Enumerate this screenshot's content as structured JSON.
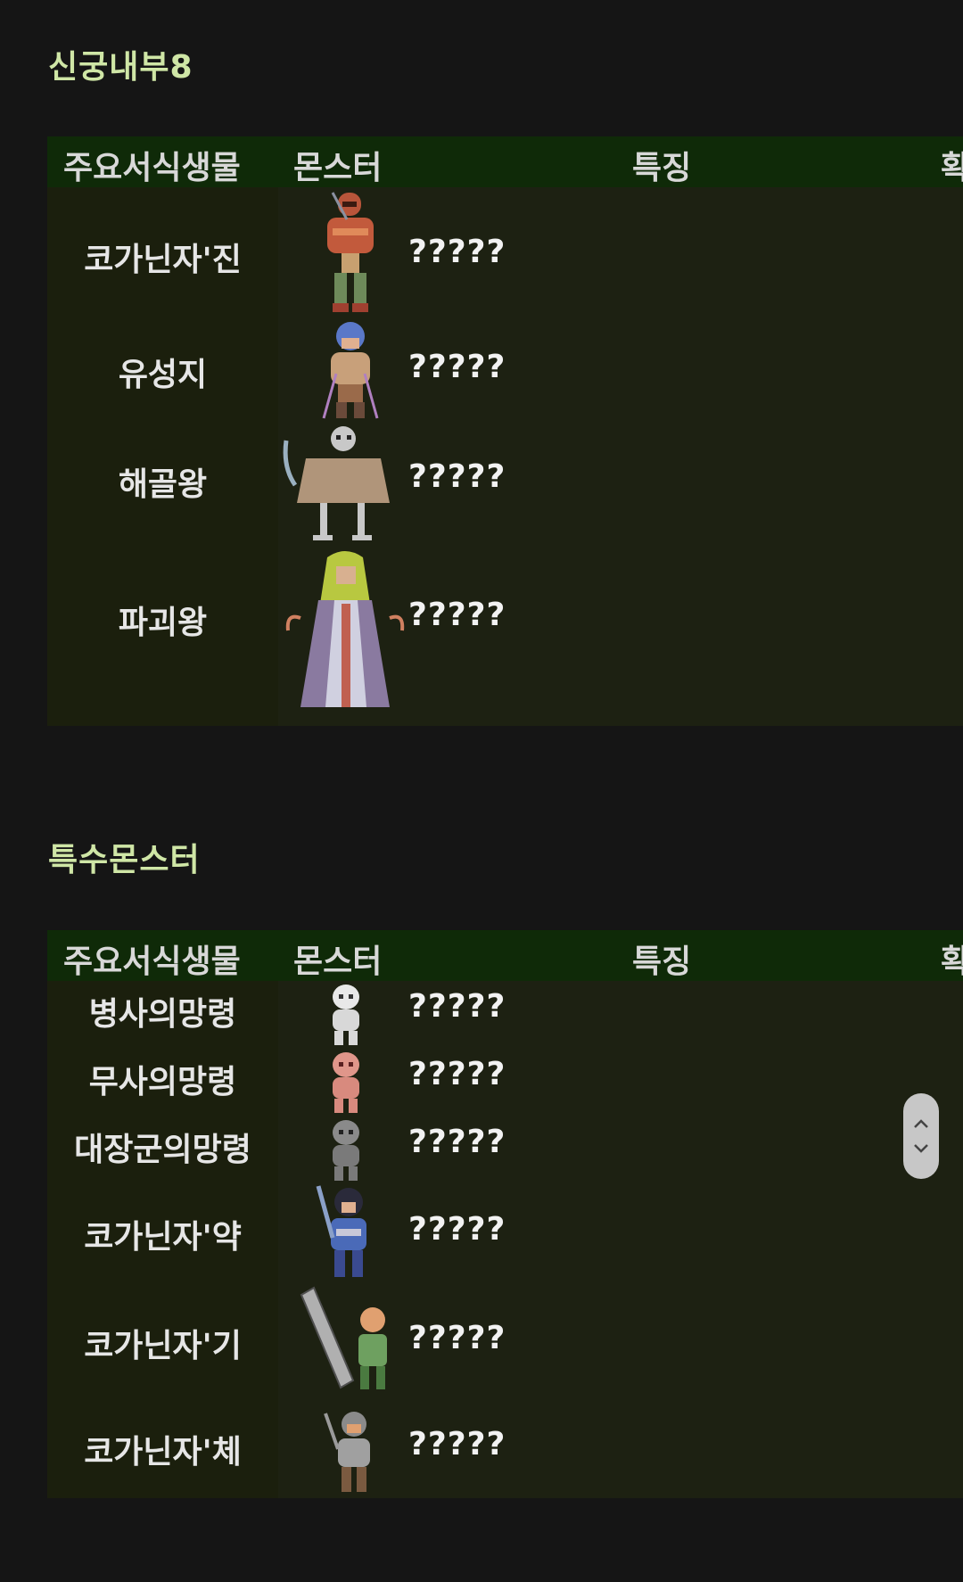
{
  "sections": [
    {
      "title": "신궁내부8",
      "headers": {
        "habitat": "주요서식생물",
        "monster": "몬스터",
        "feature": "특징",
        "extra": "확"
      },
      "rows": [
        {
          "name": "코가닌자'진",
          "desc": "?????"
        },
        {
          "name": "유성지",
          "desc": "?????"
        },
        {
          "name": "해골왕",
          "desc": "?????"
        },
        {
          "name": "파괴왕",
          "desc": "?????"
        }
      ]
    },
    {
      "title": "특수몬스터",
      "headers": {
        "habitat": "주요서식생물",
        "monster": "몬스터",
        "feature": "특징",
        "extra": "확"
      },
      "rows": [
        {
          "name": "병사의망령",
          "desc": "?????"
        },
        {
          "name": "무사의망령",
          "desc": "?????"
        },
        {
          "name": "대장군의망령",
          "desc": "?????"
        },
        {
          "name": "코가닌자'약",
          "desc": "?????"
        },
        {
          "name": "코가닌자'기",
          "desc": "?????"
        },
        {
          "name": "코가닌자'체",
          "desc": "?????"
        }
      ]
    }
  ],
  "colors": {
    "background": "#151515",
    "table": "#1d2112",
    "header": "#0f2a08",
    "title": "#cfe6a6"
  },
  "icons": [
    "ninja-sprite",
    "meteor-sprite",
    "skeleton-king-sprite",
    "destroyer-king-sprite",
    "ghost-sprite",
    "scroll-up-icon",
    "scroll-down-icon"
  ]
}
